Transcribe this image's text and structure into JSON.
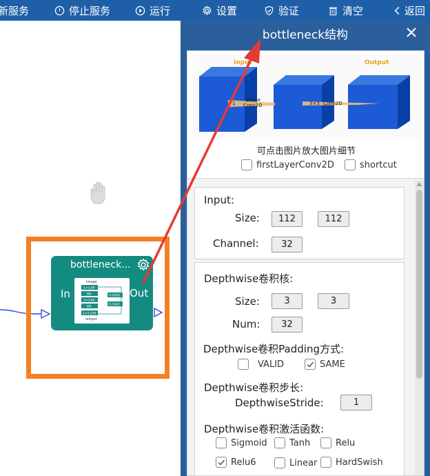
{
  "toolbar": {
    "items": [
      {
        "label": "新服务",
        "icon": "none"
      },
      {
        "label": "停止服务",
        "icon": "power-icon"
      },
      {
        "label": "运行",
        "icon": "play-icon"
      },
      {
        "label": "设置",
        "icon": "gear-icon"
      },
      {
        "label": "验证",
        "icon": "shield-icon"
      },
      {
        "label": "清空",
        "icon": "trash-icon"
      },
      {
        "label": "返回",
        "icon": "chevron-left-icon"
      }
    ]
  },
  "canvas": {
    "node": {
      "title": "bottleneck...",
      "in_label": "In",
      "out_label": "Out",
      "preview_texts": [
        "Image",
        "1×1,64",
        "BN",
        "3×3,64",
        "BN",
        "1×1,256",
        "output",
        "0.0006",
        "0.3441"
      ]
    },
    "accent_color": "#f47f24",
    "node_color": "#148b80"
  },
  "panel": {
    "title": "bottleneck结构",
    "preview": {
      "labels": {
        "input": "Input",
        "output": "Output",
        "dwise": "Dwise",
        "conv2d_a": "Conv2D",
        "op1": "1",
        "op2": "3×3",
        "conv2d_b": "Conv2D"
      },
      "hint": "可点击图片放大图片细节",
      "options": [
        {
          "label": "firstLayerConv2D",
          "checked": false
        },
        {
          "label": "shortcut",
          "checked": false
        }
      ]
    },
    "input_section": {
      "heading": "Input:",
      "size_label": "Size:",
      "size_values": [
        "112",
        "112"
      ],
      "channel_label": "Channel:",
      "channel_value": "32"
    },
    "depthwise_section": {
      "heading": "Depthwise卷积核:",
      "size_label": "Size:",
      "size_values": [
        "3",
        "3"
      ],
      "num_label": "Num:",
      "num_value": "32",
      "padding_heading": "Depthwise卷积Padding方式:",
      "padding_options": [
        {
          "label": "VALID",
          "checked": false
        },
        {
          "label": "SAME",
          "checked": true
        }
      ],
      "stride_heading": "Depthwise卷积步长:",
      "stride_label": "DepthwiseStride:",
      "stride_value": "1",
      "activation_heading": "Depthwise卷积激活函数:",
      "activations": [
        {
          "label": "Sigmoid",
          "checked": false
        },
        {
          "label": "Tanh",
          "checked": false
        },
        {
          "label": "Relu",
          "checked": false
        },
        {
          "label": "Relu6",
          "checked": true
        },
        {
          "label": "Linear",
          "checked": false
        },
        {
          "label": "HardSwish",
          "checked": false
        }
      ]
    }
  },
  "colors": {
    "toolbar": "#1f5fa8",
    "panel": "#2a5f9c",
    "arrow": "#e53935"
  }
}
